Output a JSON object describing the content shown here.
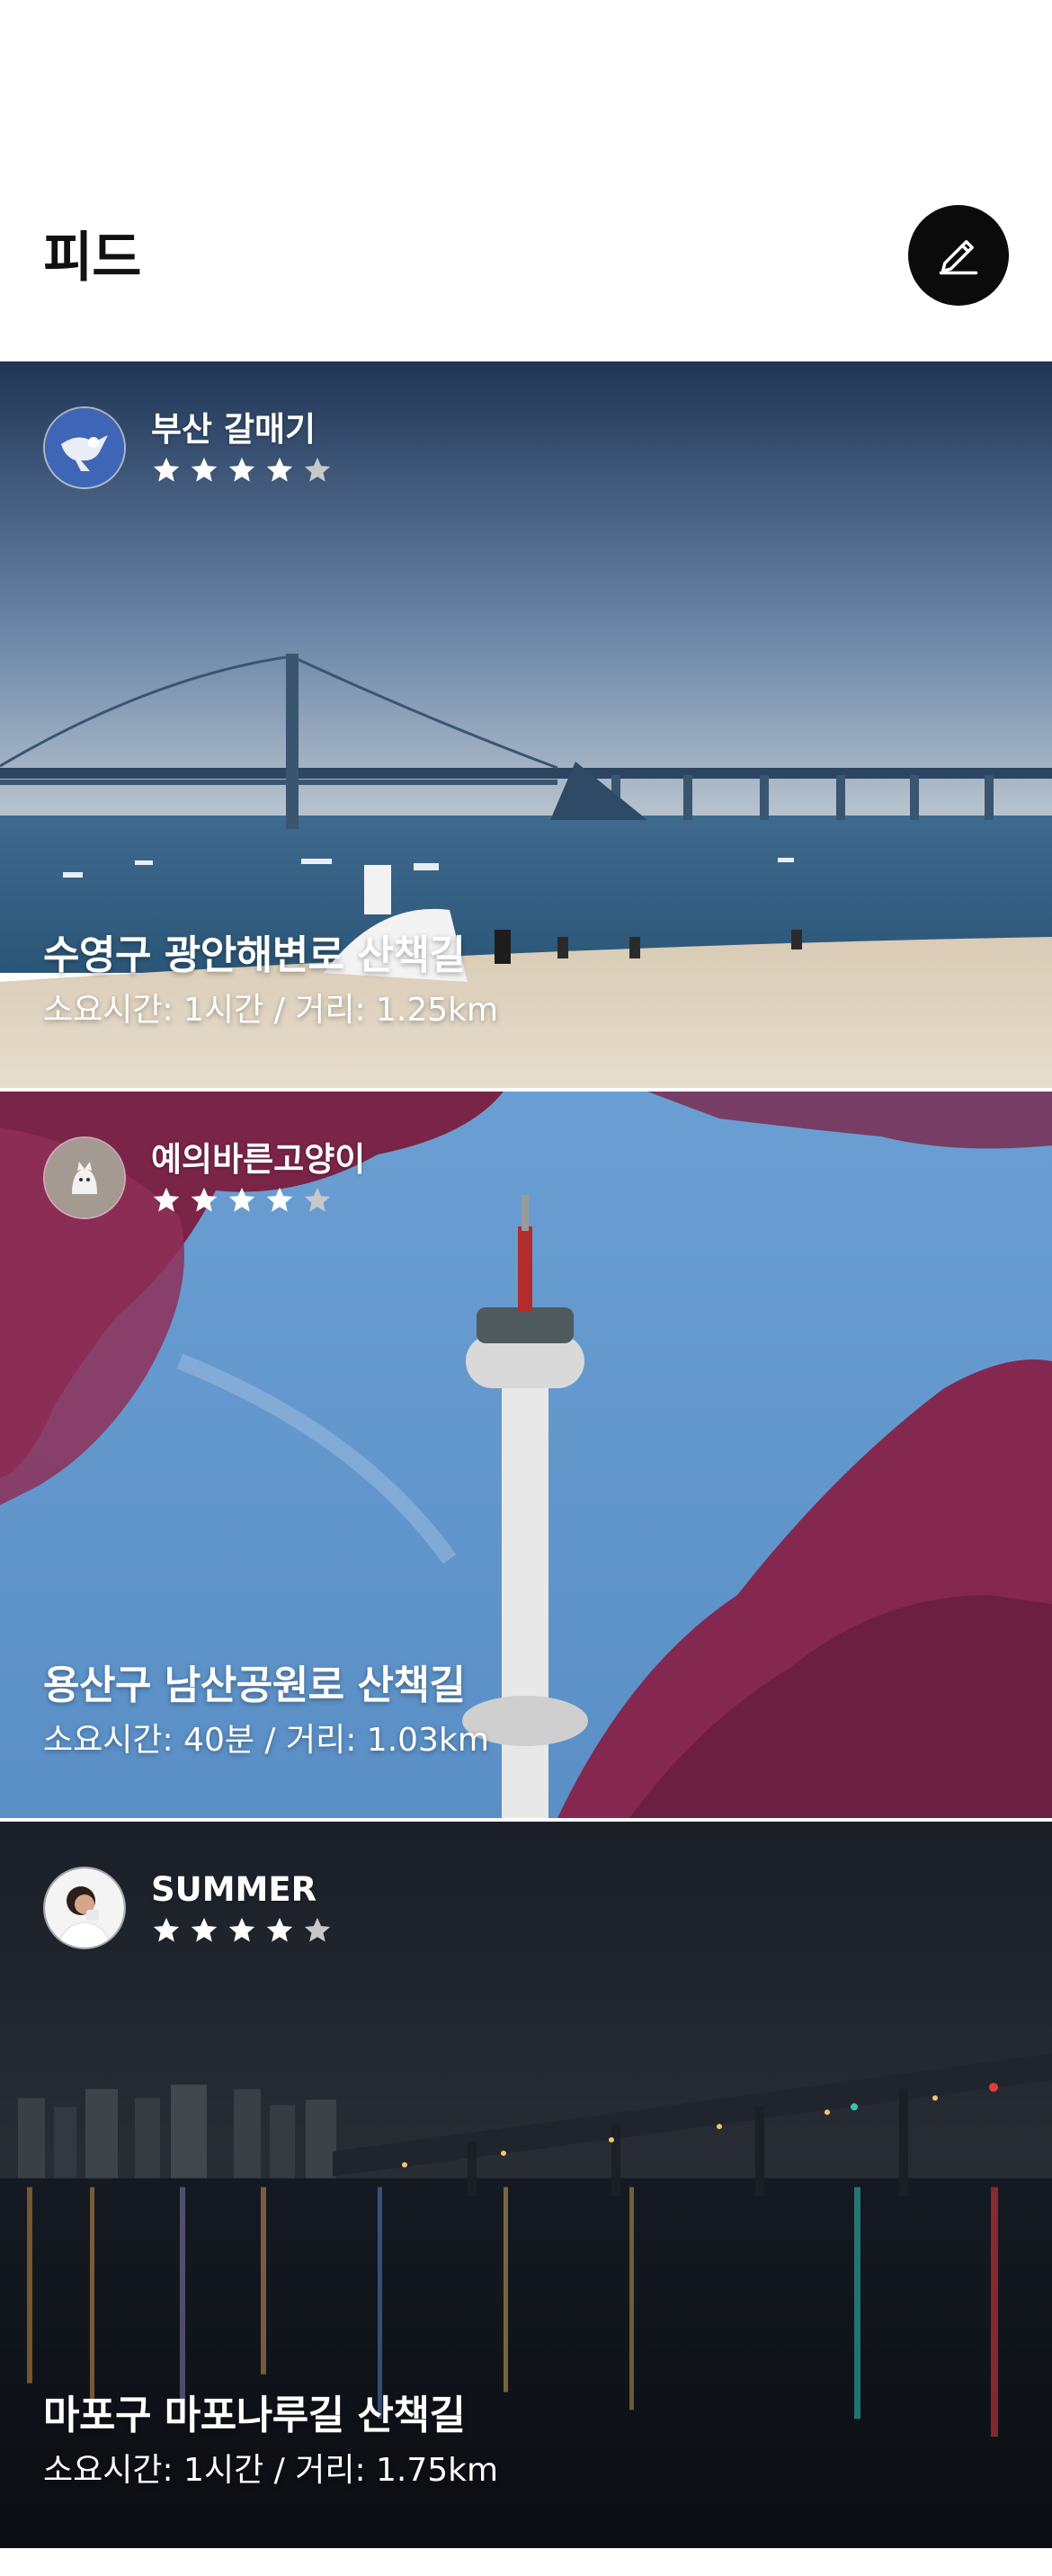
{
  "header": {
    "title": "피드",
    "write_icon": "pencil-icon"
  },
  "feed": [
    {
      "author": "부산 갈매기",
      "avatar_icon": "seagull-avatar",
      "rating": 4,
      "rating_max": 5,
      "title": "수영구 광안해변로 산책길",
      "meta": "소요시간: 1시간 / 거리: 1.25km"
    },
    {
      "author": "예의바른고양이",
      "avatar_icon": "cat-avatar",
      "rating": 4,
      "rating_max": 5,
      "title": "용산구 남산공원로 산책길",
      "meta": "소요시간: 40분 / 거리: 1.03km"
    },
    {
      "author": "SUMMER",
      "avatar_icon": "person-avatar",
      "rating": 4,
      "rating_max": 5,
      "title": "마포구 마포나루길 산책길",
      "meta": "소요시간: 1시간 / 거리: 1.75km"
    }
  ],
  "colors": {
    "star_filled": "#ffffff",
    "star_empty": "#c8c8c8",
    "button_bg": "#0b0b0b"
  }
}
